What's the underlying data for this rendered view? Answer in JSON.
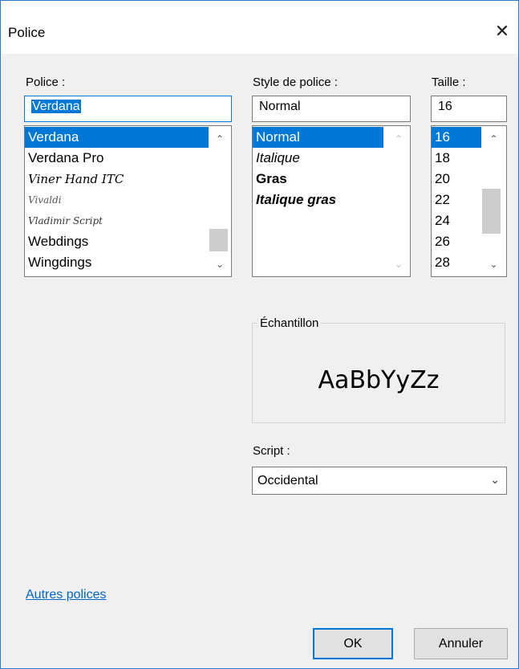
{
  "window": {
    "title": "Police",
    "close_icon": "close-icon"
  },
  "font": {
    "label": "Police :",
    "value": "Verdana",
    "items": [
      "Verdana",
      "Verdana Pro",
      "Viner Hand ITC",
      "Vivaldi",
      "Vladimir Script",
      "Webdings",
      "Wingdings"
    ],
    "selected": "Verdana"
  },
  "style": {
    "label": "Style de police :",
    "value": "Normal",
    "items": [
      "Normal",
      "Italique",
      "Gras",
      "Italique gras"
    ],
    "selected": "Normal"
  },
  "size": {
    "label": "Taille :",
    "value": "16",
    "items": [
      "16",
      "18",
      "20",
      "22",
      "24",
      "26",
      "28"
    ],
    "selected": "16"
  },
  "sample": {
    "label": "Échantillon",
    "text": "AaBbYyZz"
  },
  "script": {
    "label": "Script :",
    "value": "Occidental"
  },
  "more_fonts_link": "Autres polices",
  "buttons": {
    "ok": "OK",
    "cancel": "Annuler"
  },
  "colors": {
    "selection": "#0078d7",
    "dialog_bg": "#f0f0f0",
    "link": "#0066cc",
    "focus_border": "#0078d7"
  }
}
